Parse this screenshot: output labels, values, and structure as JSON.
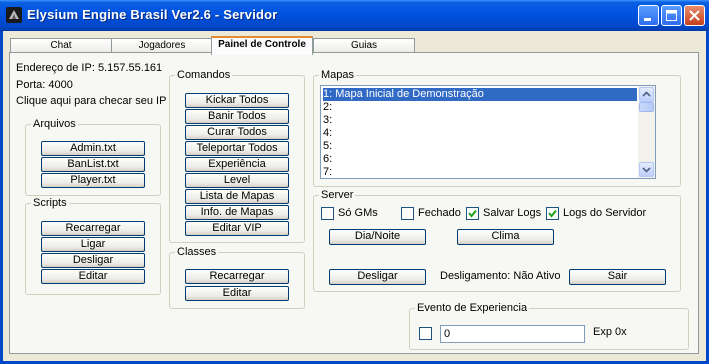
{
  "window": {
    "title": "Elysium Engine Brasil Ver2.6 - Servidor"
  },
  "tabs": [
    "Chat",
    "Jogadores",
    "Painel de Controle",
    "Guias"
  ],
  "info": {
    "ip_line": "Endereço de IP: 5.157.55.161",
    "port_line": "Porta:  4000",
    "check_ip": "Clique aqui para checar seu IP"
  },
  "arquivos": {
    "label": "Arquivos",
    "buttons": [
      "Admin.txt",
      "BanList.txt",
      "Player.txt"
    ]
  },
  "scripts": {
    "label": "Scripts",
    "buttons": [
      "Recarregar",
      "Ligar",
      "Desligar",
      "Editar"
    ]
  },
  "comandos": {
    "label": "Comandos",
    "buttons": [
      "Kickar Todos",
      "Banir Todos",
      "Curar Todos",
      "Teleportar Todos",
      "Experiência",
      "Level",
      "Lista de Mapas",
      "Info. de Mapas",
      "Editar VIP"
    ]
  },
  "classes": {
    "label": "Classes",
    "buttons": [
      "Recarregar",
      "Editar"
    ]
  },
  "mapas": {
    "label": "Mapas",
    "items": [
      "1: Mapa Inicial de Demonstração",
      "2:",
      "3:",
      "4:",
      "5:",
      "6:",
      "7:"
    ]
  },
  "server": {
    "label": "Server",
    "checkboxes": [
      {
        "label": "Só GMs",
        "checked": false
      },
      {
        "label": "Fechado",
        "checked": false
      },
      {
        "label": "Salvar Logs",
        "checked": true
      },
      {
        "label": "Logs do Servidor",
        "checked": true
      }
    ],
    "dia_noite": "Dia/Noite",
    "clima": "Clima",
    "desligar": "Desligar",
    "desligamento_status": "Desligamento: Não Ativo",
    "sair": "Sair"
  },
  "evento": {
    "label": "Evento de Experiencia",
    "value": "0",
    "exp_label": "Exp 0x",
    "checked": false
  },
  "colors": {
    "title_bar": "#0054e3",
    "selection": "#316ac5",
    "close_button": "#c6401c"
  }
}
